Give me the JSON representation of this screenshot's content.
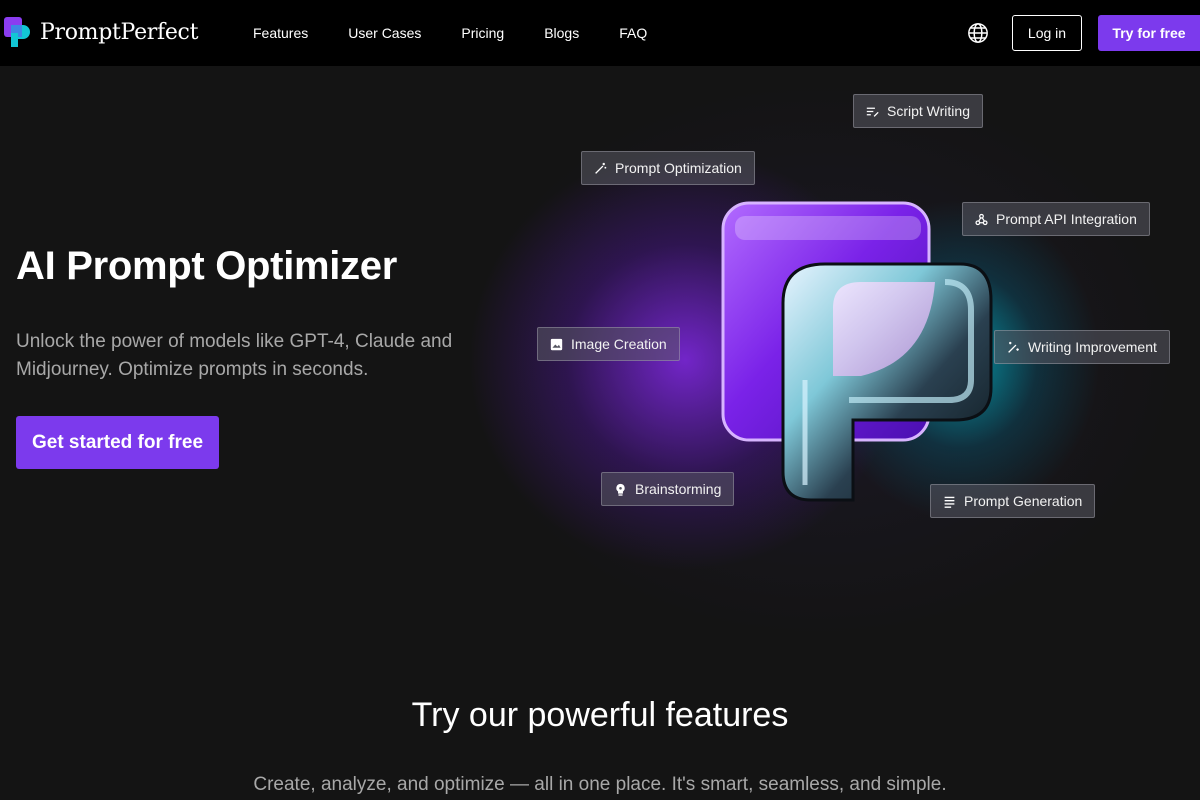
{
  "header": {
    "logo_text": "PromptPerfect",
    "nav": [
      {
        "label": "Features"
      },
      {
        "label": "User Cases"
      },
      {
        "label": "Pricing"
      },
      {
        "label": "Blogs"
      },
      {
        "label": "FAQ"
      }
    ],
    "language_icon": "globe-icon",
    "login_label": "Log in",
    "try_label": "Try for free"
  },
  "hero": {
    "title": "AI Prompt Optimizer",
    "subtitle": "Unlock the power of models like GPT-4, Claude and Midjourney. Optimize prompts in seconds.",
    "cta_label": "Get started for free"
  },
  "chips": {
    "script_writing": {
      "label": "Script Writing",
      "icon": "text-edit-icon"
    },
    "prompt_optimization": {
      "label": "Prompt Optimization",
      "icon": "magic-wand-icon"
    },
    "prompt_api": {
      "label": "Prompt API Integration",
      "icon": "api-icon"
    },
    "image_creation": {
      "label": "Image Creation",
      "icon": "image-icon"
    },
    "writing_improvement": {
      "label": "Writing Improvement",
      "icon": "sparkle-edit-icon"
    },
    "brainstorming": {
      "label": "Brainstorming",
      "icon": "lightbulb-icon"
    },
    "prompt_generation": {
      "label": "Prompt Generation",
      "icon": "lines-icon"
    }
  },
  "features": {
    "title": "Try our powerful features",
    "subtitle": "Create, analyze, and optimize — all in one place. It's smart, seamless, and simple."
  },
  "colors": {
    "accent": "#7c3aed",
    "background": "#141414",
    "header_bg": "#000000",
    "muted_text": "#a8a8a8"
  }
}
